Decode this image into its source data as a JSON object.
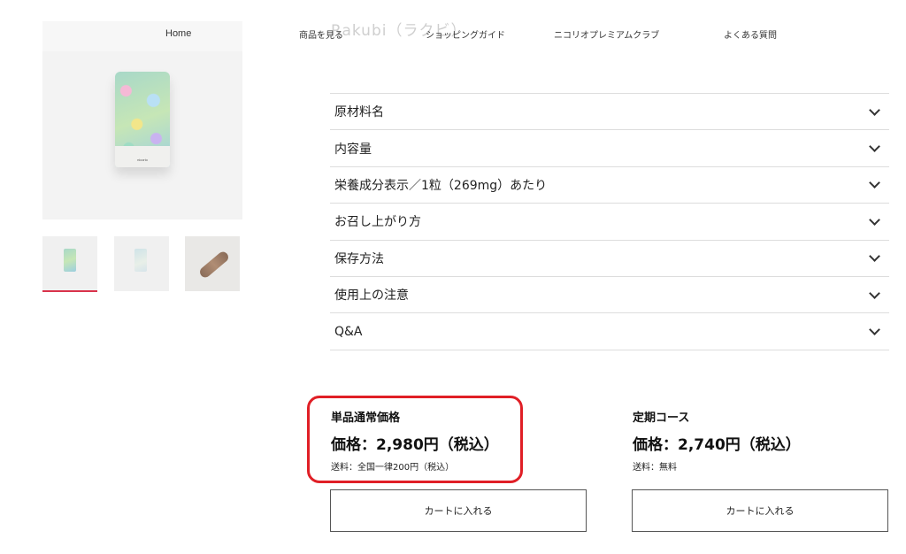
{
  "nav": {
    "home": "Home",
    "items": [
      "商品を見る",
      "ショッピングガイド",
      "ニコリオプレミアムクラブ",
      "よくある質問"
    ]
  },
  "product": {
    "ghost_title": "Rakubi（ラクビ）",
    "pouch_brand": "nicorio"
  },
  "accordion": {
    "items": [
      "原材料名",
      "内容量",
      "栄養成分表示／1粒（269mg）あたり",
      "お召し上がり方",
      "保存方法",
      "使用上の注意",
      "Q&A"
    ]
  },
  "pricing": {
    "single": {
      "title": "単品通常価格",
      "price": "価格：2,980円（税込）",
      "shipping": "送料：全国一律200円（税込）",
      "cart_label": "カートに入れる"
    },
    "subscription": {
      "title": "定期コース",
      "price": "価格：2,740円（税込）",
      "shipping": "送料：無料",
      "cart_label": "カートに入れる"
    }
  },
  "colors": {
    "highlight": "#e01f26",
    "active_thumb": "#d9334b"
  }
}
